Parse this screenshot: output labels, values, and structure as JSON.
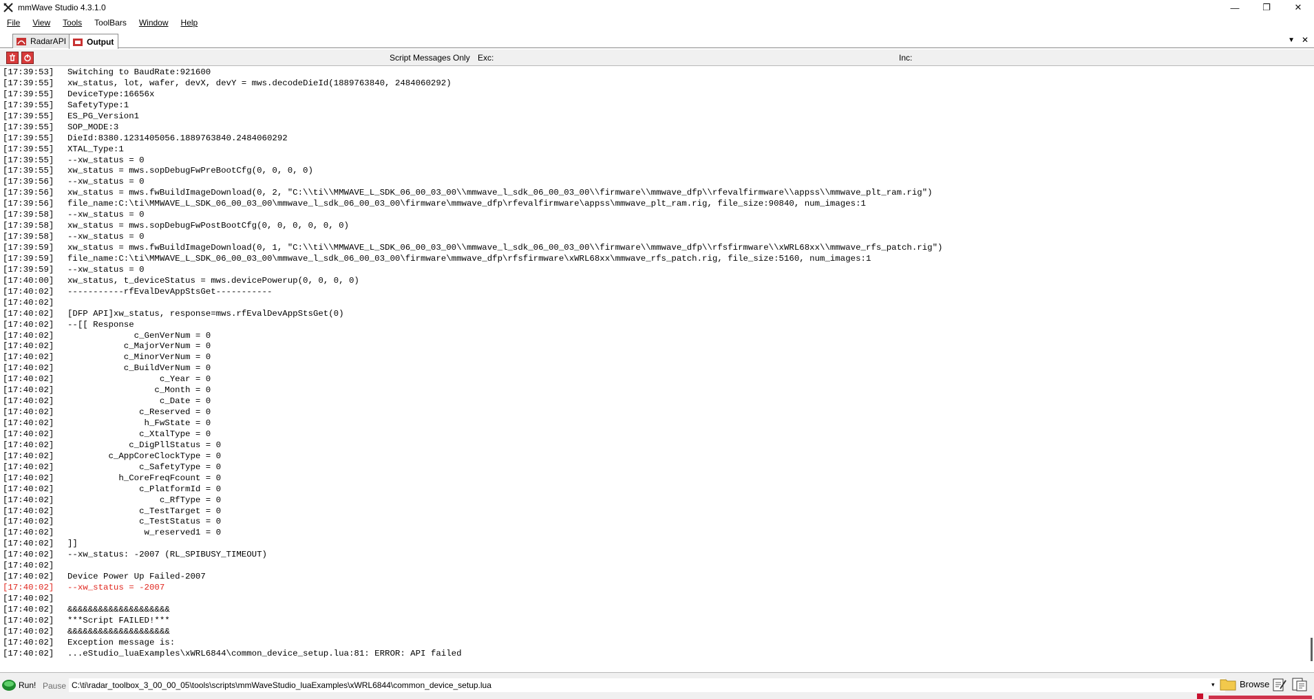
{
  "window": {
    "title": "mmWave Studio 4.3.1.0",
    "minimize_glyph": "—",
    "maximize_glyph": "❐",
    "close_glyph": "✕"
  },
  "menu": {
    "items": [
      {
        "label": "File"
      },
      {
        "label": "View"
      },
      {
        "label": "Tools"
      },
      {
        "label": "ToolBars"
      },
      {
        "label": "Window"
      },
      {
        "label": "Help"
      }
    ]
  },
  "tabs": [
    {
      "label": "RadarAPI",
      "active": false,
      "icon": "radar-api-icon"
    },
    {
      "label": "Output",
      "active": true,
      "icon": "output-icon"
    }
  ],
  "tabbar": {
    "menu_arrow": "▼",
    "close_glyph": "✕"
  },
  "filter": {
    "script_messages_only": "Script Messages Only",
    "exc_label": "Exc:",
    "exc_value": "",
    "inc_label": "Inc:",
    "inc_value": ""
  },
  "log": [
    {
      "ts": "[17:39:53]",
      "msg": "Switching to BaudRate:921600",
      "error": false
    },
    {
      "ts": "[17:39:55]",
      "msg": "xw_status, lot, wafer, devX, devY = mws.decodeDieId(1889763840, 2484060292)",
      "error": false
    },
    {
      "ts": "[17:39:55]",
      "msg": "DeviceType:16656x",
      "error": false
    },
    {
      "ts": "[17:39:55]",
      "msg": "SafetyType:1",
      "error": false
    },
    {
      "ts": "[17:39:55]",
      "msg": "ES_PG_Version1",
      "error": false
    },
    {
      "ts": "[17:39:55]",
      "msg": "SOP_MODE:3",
      "error": false
    },
    {
      "ts": "[17:39:55]",
      "msg": "DieId:8380.1231405056.1889763840.2484060292",
      "error": false
    },
    {
      "ts": "[17:39:55]",
      "msg": "XTAL_Type:1",
      "error": false
    },
    {
      "ts": "[17:39:55]",
      "msg": "--xw_status = 0",
      "error": false
    },
    {
      "ts": "[17:39:55]",
      "msg": "xw_status = mws.sopDebugFwPreBootCfg(0, 0, 0, 0)",
      "error": false
    },
    {
      "ts": "[17:39:56]",
      "msg": "--xw_status = 0",
      "error": false
    },
    {
      "ts": "[17:39:56]",
      "msg": "xw_status = mws.fwBuildImageDownload(0, 2, \"C:\\\\ti\\\\MMWAVE_L_SDK_06_00_03_00\\\\mmwave_l_sdk_06_00_03_00\\\\firmware\\\\mmwave_dfp\\\\rfevalfirmware\\\\appss\\\\mmwave_plt_ram.rig\")",
      "error": false
    },
    {
      "ts": "[17:39:56]",
      "msg": "file_name:C:\\ti\\MMWAVE_L_SDK_06_00_03_00\\mmwave_l_sdk_06_00_03_00\\firmware\\mmwave_dfp\\rfevalfirmware\\appss\\mmwave_plt_ram.rig, file_size:90840, num_images:1",
      "error": false
    },
    {
      "ts": "[17:39:58]",
      "msg": "--xw_status = 0",
      "error": false
    },
    {
      "ts": "[17:39:58]",
      "msg": "xw_status = mws.sopDebugFwPostBootCfg(0, 0, 0, 0, 0, 0)",
      "error": false
    },
    {
      "ts": "[17:39:58]",
      "msg": "--xw_status = 0",
      "error": false
    },
    {
      "ts": "[17:39:59]",
      "msg": "xw_status = mws.fwBuildImageDownload(0, 1, \"C:\\\\ti\\\\MMWAVE_L_SDK_06_00_03_00\\\\mmwave_l_sdk_06_00_03_00\\\\firmware\\\\mmwave_dfp\\\\rfsfirmware\\\\xWRL68xx\\\\mmwave_rfs_patch.rig\")",
      "error": false
    },
    {
      "ts": "[17:39:59]",
      "msg": "file_name:C:\\ti\\MMWAVE_L_SDK_06_00_03_00\\mmwave_l_sdk_06_00_03_00\\firmware\\mmwave_dfp\\rfsfirmware\\xWRL68xx\\mmwave_rfs_patch.rig, file_size:5160, num_images:1",
      "error": false
    },
    {
      "ts": "[17:39:59]",
      "msg": "--xw_status = 0",
      "error": false
    },
    {
      "ts": "[17:40:00]",
      "msg": "xw_status, t_deviceStatus = mws.devicePowerup(0, 0, 0, 0)",
      "error": false
    },
    {
      "ts": "[17:40:02]",
      "msg": "-----------rfEvalDevAppStsGet-----------",
      "error": false
    },
    {
      "ts": "[17:40:02]",
      "msg": "",
      "error": false
    },
    {
      "ts": "[17:40:02]",
      "msg": "[DFP API]xw_status, response=mws.rfEvalDevAppStsGet(0)",
      "error": false
    },
    {
      "ts": "[17:40:02]",
      "msg": "--[[ Response",
      "error": false
    },
    {
      "ts": "[17:40:02]",
      "msg": "             c_GenVerNum = 0",
      "error": false
    },
    {
      "ts": "[17:40:02]",
      "msg": "           c_MajorVerNum = 0",
      "error": false
    },
    {
      "ts": "[17:40:02]",
      "msg": "           c_MinorVerNum = 0",
      "error": false
    },
    {
      "ts": "[17:40:02]",
      "msg": "           c_BuildVerNum = 0",
      "error": false
    },
    {
      "ts": "[17:40:02]",
      "msg": "                  c_Year = 0",
      "error": false
    },
    {
      "ts": "[17:40:02]",
      "msg": "                 c_Month = 0",
      "error": false
    },
    {
      "ts": "[17:40:02]",
      "msg": "                  c_Date = 0",
      "error": false
    },
    {
      "ts": "[17:40:02]",
      "msg": "              c_Reserved = 0",
      "error": false
    },
    {
      "ts": "[17:40:02]",
      "msg": "               h_FwState = 0",
      "error": false
    },
    {
      "ts": "[17:40:02]",
      "msg": "              c_XtalType = 0",
      "error": false
    },
    {
      "ts": "[17:40:02]",
      "msg": "            c_DigPllStatus = 0",
      "error": false
    },
    {
      "ts": "[17:40:02]",
      "msg": "        c_AppCoreClockType = 0",
      "error": false
    },
    {
      "ts": "[17:40:02]",
      "msg": "              c_SafetyType = 0",
      "error": false
    },
    {
      "ts": "[17:40:02]",
      "msg": "          h_CoreFreqFcount = 0",
      "error": false
    },
    {
      "ts": "[17:40:02]",
      "msg": "              c_PlatformId = 0",
      "error": false
    },
    {
      "ts": "[17:40:02]",
      "msg": "                  c_RfType = 0",
      "error": false
    },
    {
      "ts": "[17:40:02]",
      "msg": "              c_TestTarget = 0",
      "error": false
    },
    {
      "ts": "[17:40:02]",
      "msg": "              c_TestStatus = 0",
      "error": false
    },
    {
      "ts": "[17:40:02]",
      "msg": "               w_reserved1 = 0",
      "error": false
    },
    {
      "ts": "[17:40:02]",
      "msg": "]]",
      "error": false
    },
    {
      "ts": "[17:40:02]",
      "msg": "--xw_status: -2007 (RL_SPIBUSY_TIMEOUT)",
      "error": false
    },
    {
      "ts": "[17:40:02]",
      "msg": "",
      "error": false
    },
    {
      "ts": "[17:40:02]",
      "msg": "Device Power Up Failed-2007",
      "error": false
    },
    {
      "ts": "[17:40:02]",
      "msg": "--xw_status = -2007",
      "error": true
    },
    {
      "ts": "[17:40:02]",
      "msg": "",
      "error": false
    },
    {
      "ts": "[17:40:02]",
      "msg": "&&&&&&&&&&&&&&&&&&&&",
      "error": false
    },
    {
      "ts": "[17:40:02]",
      "msg": "***Script FAILED!***",
      "error": false
    },
    {
      "ts": "[17:40:02]",
      "msg": "&&&&&&&&&&&&&&&&&&&&",
      "error": false
    },
    {
      "ts": "[17:40:02]",
      "msg": "Exception message is:",
      "error": false
    },
    {
      "ts": "[17:40:02]",
      "msg": "...eStudio_luaExamples\\xWRL6844\\common_device_setup.lua:81: ERROR: API failed",
      "error": false
    }
  ],
  "bottom": {
    "run_label": "Run!",
    "pause_label": "Pause",
    "script_path": "C:\\ti\\radar_toolbox_3_00_00_05\\tools\\scripts\\mmWaveStudio_luaExamples\\xWRL6844\\common_device_setup.lua",
    "dropdown_glyph": "▾",
    "browse_label": "Browse"
  },
  "colors": {
    "error_text": "#e0261e",
    "accent_red": "#d73a3a"
  }
}
